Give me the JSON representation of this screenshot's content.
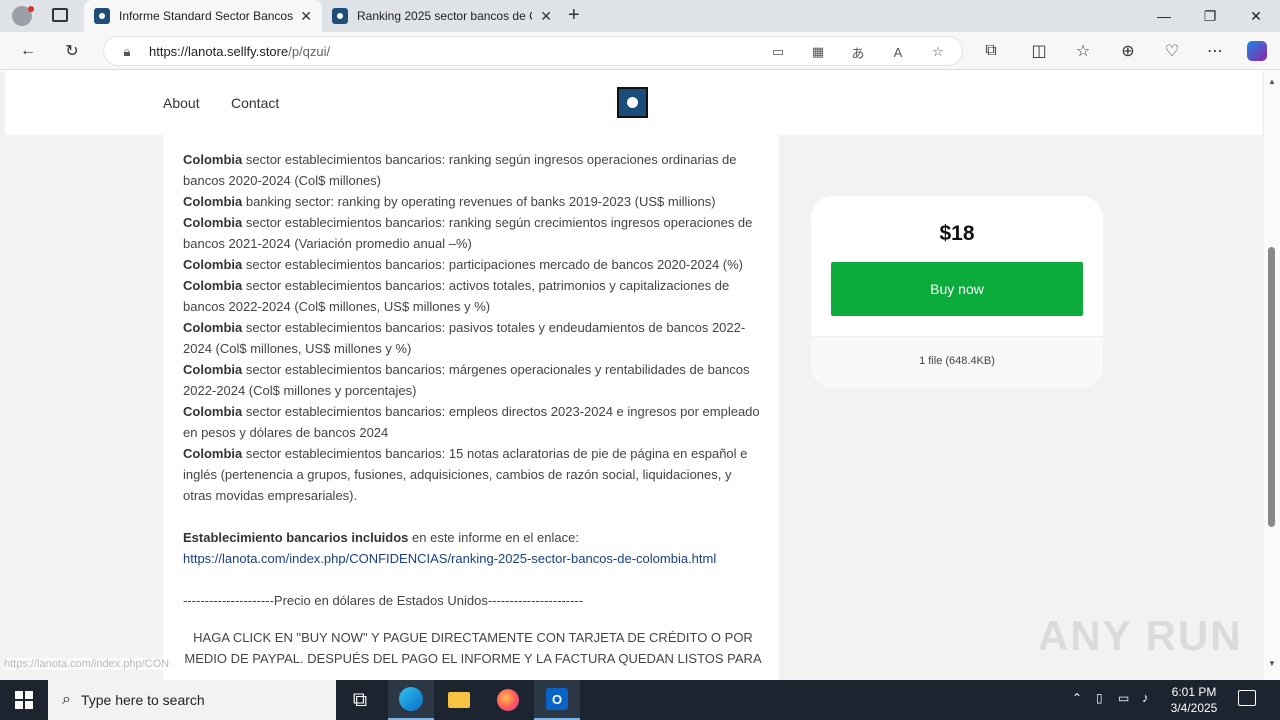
{
  "browser": {
    "tabs": [
      {
        "title": "Informe Standard Sector Bancos"
      },
      {
        "title": "Ranking 2025 sector bancos de C"
      }
    ],
    "url_host": "https://lanota.sellfy.store",
    "url_path": "/p/qzui/"
  },
  "site": {
    "nav": {
      "about": "About",
      "contact": "Contact"
    }
  },
  "description": {
    "items": [
      {
        "bold": "Colombia",
        "text": " sector establecimientos bancarios: ranking según ingresos operaciones ordinarias de bancos 2020-2024 (Col$ millones)"
      },
      {
        "bold": "Colombia",
        "text": " banking sector: ranking by operating revenues of banks 2019-2023 (US$ millions)"
      },
      {
        "bold": "Colombia",
        "text": " sector establecimientos bancarios: ranking según crecimientos ingresos operaciones de bancos 2021-2024 (Variación promedio anual –%)"
      },
      {
        "bold": "Colombia",
        "text": " sector establecimientos bancarios: participaciones mercado de bancos 2020-2024 (%)"
      },
      {
        "bold": "Colombia",
        "text": " sector establecimientos bancarios: activos totales, patrimonios y capitalizaciones de bancos 2022-2024 (Col$ millones, US$ millones y %)"
      },
      {
        "bold": "Colombia",
        "text": " sector establecimientos bancarios: pasivos totales y endeudamientos de bancos 2022-2024 (Col$ millones, US$ millones y %)"
      },
      {
        "bold": "Colombia",
        "text": " sector establecimientos bancarios: márgenes operacionales y rentabilidades de bancos 2022-2024 (Col$ millones y porcentajes)"
      },
      {
        "bold": "Colombia",
        "text": " sector establecimientos bancarios: empleos directos 2023-2024 e ingresos por empleado en pesos y dólares de bancos 2024"
      },
      {
        "bold": "Colombia",
        "text": " sector establecimientos bancarios: 15 notas aclaratorias de pie de página en español e inglés (pertenencia a grupos, fusiones, adquisiciones, cambios de razón social, liquidaciones, y otras movidas empresariales)."
      }
    ],
    "included_bold": "Establecimiento bancarios incluidos",
    "included_text": " en este informe en el enlace:",
    "included_link": "https://lanota.com/index.php/CONFIDENCIAS/ranking-2025-sector-bancos-de-colombia.html",
    "price_note": "---------------------Precio en dólares de Estados Unidos----------------------",
    "instructions": "HAGA CLICK EN \"BUY NOW\" Y PAGUE DIRECTAMENTE CON TARJETA DE CRÉDITO O POR MEDIO DE PAYPAL. DESPUÉS DEL PAGO EL INFORME Y LA FACTURA QUEDAN LISTOS PARA"
  },
  "card": {
    "price": "$18",
    "buy_label": "Buy now",
    "file_info": "1 file (648.4KB)"
  },
  "status_url": "https://lanota.com/index.php/CON",
  "watermark": "ANY RUN",
  "taskbar": {
    "search_placeholder": "Type here to search",
    "time": "6:01 PM",
    "date": "3/4/2025"
  }
}
